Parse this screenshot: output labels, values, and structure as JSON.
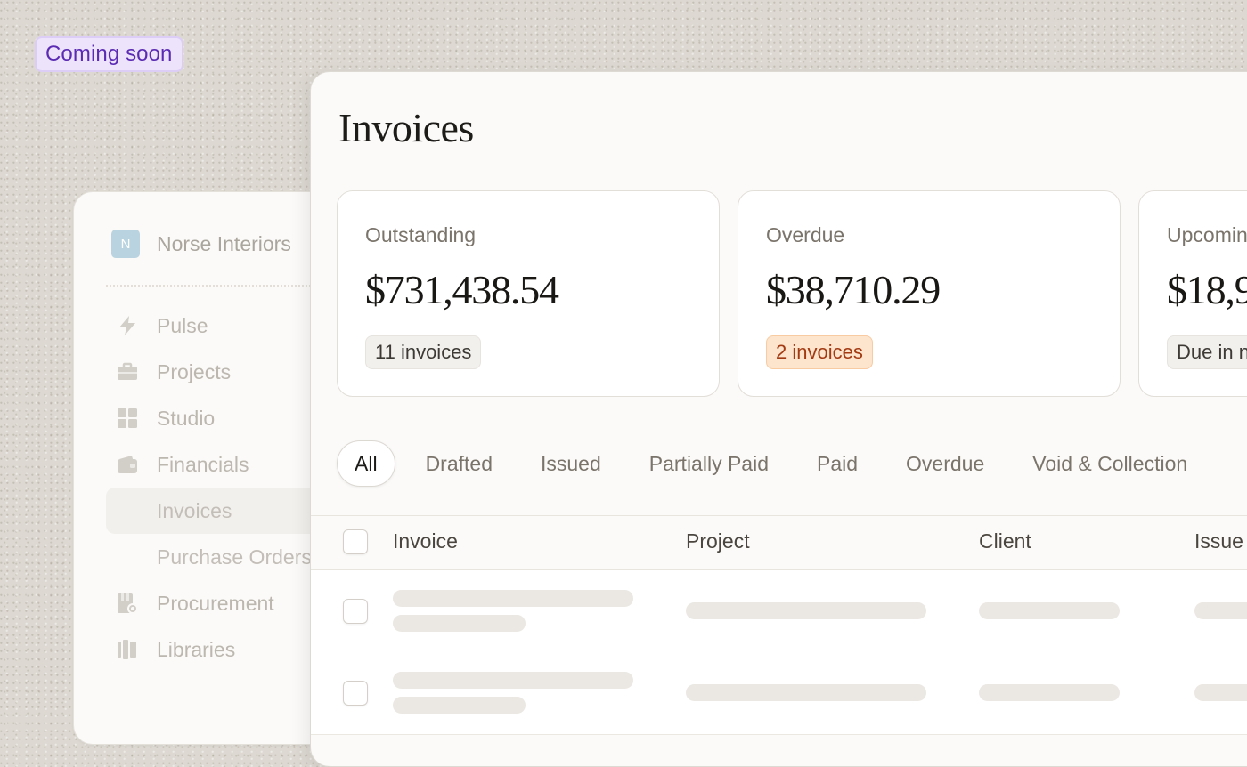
{
  "badge": "Coming soon",
  "sidebar": {
    "org_initial": "N",
    "org_name": "Norse Interiors",
    "items": [
      {
        "label": "Pulse",
        "icon": "lightning-icon"
      },
      {
        "label": "Projects",
        "icon": "briefcase-icon"
      },
      {
        "label": "Studio",
        "icon": "grid-icon"
      },
      {
        "label": "Financials",
        "icon": "wallet-icon"
      },
      {
        "label": "Invoices",
        "icon": "",
        "active": true
      },
      {
        "label": "Purchase Orders",
        "icon": ""
      },
      {
        "label": "Procurement",
        "icon": "clipboard-icon"
      },
      {
        "label": "Libraries",
        "icon": "books-icon"
      }
    ]
  },
  "main": {
    "title": "Invoices",
    "cards": [
      {
        "label": "Outstanding",
        "amount": "$731,438.54",
        "pill": "11 invoices",
        "pill_style": "neutral"
      },
      {
        "label": "Overdue",
        "amount": "$38,710.29",
        "pill": "2 invoices",
        "pill_style": "warn"
      },
      {
        "label": "Upcoming",
        "amount": "$18,9",
        "pill": "Due in n",
        "pill_style": "neutral"
      }
    ],
    "tabs": [
      "All",
      "Drafted",
      "Issued",
      "Partially Paid",
      "Paid",
      "Overdue",
      "Void & Collection"
    ],
    "active_tab": "All",
    "columns": [
      "Invoice",
      "Project",
      "Client",
      "Issue"
    ]
  },
  "colors": {
    "badge_text": "#5b2bb3",
    "warn_pill_text": "#a23a12",
    "warn_pill_bg": "#fde4cd",
    "org_avatar": "#b9d4e0"
  }
}
